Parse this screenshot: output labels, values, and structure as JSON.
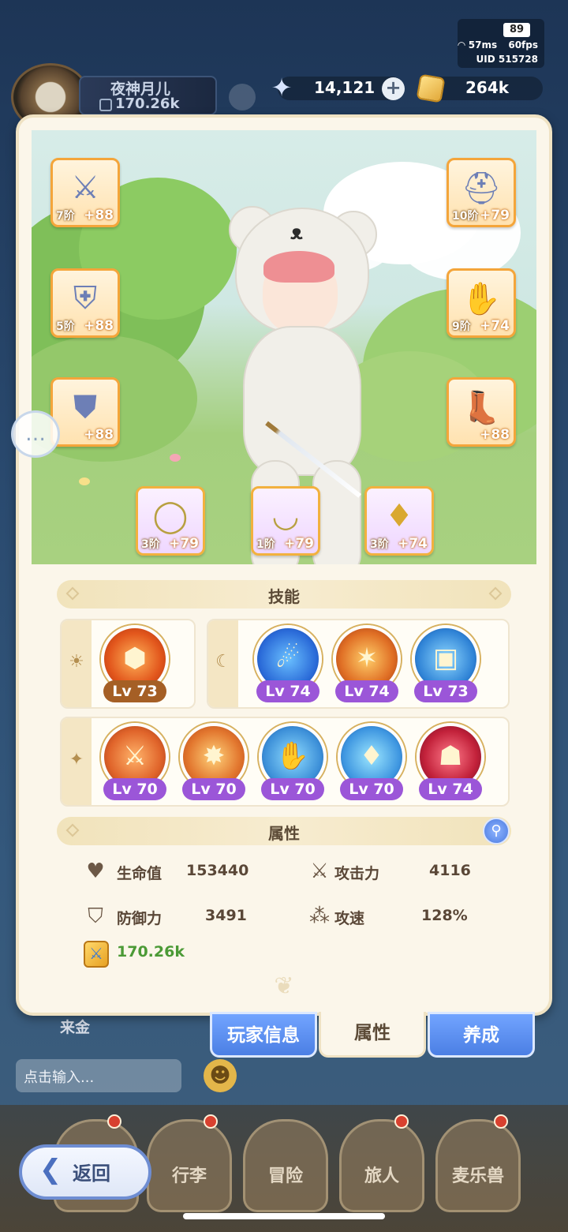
{
  "status": {
    "battery": "89",
    "ping": "57ms",
    "fps": "60fps",
    "uid": "UID 515728"
  },
  "player": {
    "name": "夜神月儿",
    "power": "170.26k"
  },
  "resources": {
    "crystals": "14,121",
    "plus_icon": "plus-icon",
    "gold": "264k"
  },
  "equipment": [
    {
      "slot": "weapon",
      "tier": "7阶",
      "plus": "+88",
      "icon": "sword-icon"
    },
    {
      "slot": "helmet",
      "tier": "10阶",
      "plus": "+79",
      "icon": "helmet-icon"
    },
    {
      "slot": "armor",
      "tier": "5阶",
      "plus": "+88",
      "icon": "chest-armor-icon"
    },
    {
      "slot": "gloves",
      "tier": "9阶",
      "plus": "+74",
      "icon": "gauntlet-icon"
    },
    {
      "slot": "pants",
      "tier": "",
      "plus": "+88",
      "icon": "leg-armor-icon"
    },
    {
      "slot": "boots",
      "tier": "",
      "plus": "+88",
      "icon": "boots-icon"
    },
    {
      "slot": "ring",
      "tier": "3阶",
      "plus": "+79",
      "icon": "ring-icon"
    },
    {
      "slot": "necklace",
      "tier": "1阶",
      "plus": "+79",
      "icon": "necklace-icon"
    },
    {
      "slot": "earring",
      "tier": "3阶",
      "plus": "+74",
      "icon": "earring-icon"
    }
  ],
  "skills": {
    "title": "技能",
    "sun_group": [
      {
        "level": "Lv 73",
        "icon": "fire-shield-skill-icon"
      }
    ],
    "moon_group": [
      {
        "level": "Lv 74",
        "icon": "blue-aura-skill-icon"
      },
      {
        "level": "Lv 74",
        "icon": "flame-strike-skill-icon"
      },
      {
        "level": "Lv 73",
        "icon": "ice-guard-skill-icon"
      }
    ],
    "star_group": [
      {
        "level": "Lv 70",
        "icon": "sword-shield-skill-icon"
      },
      {
        "level": "Lv 70",
        "icon": "burst-skill-icon"
      },
      {
        "level": "Lv 70",
        "icon": "grab-skill-icon"
      },
      {
        "level": "Lv 70",
        "icon": "blade-wind-skill-icon"
      },
      {
        "level": "Lv 74",
        "icon": "shadow-skill-icon"
      }
    ]
  },
  "attributes": {
    "title": "属性",
    "hp_label": "生命值",
    "hp_value": "153440",
    "atk_label": "攻击力",
    "atk_value": "4116",
    "def_label": "防御力",
    "def_value": "3491",
    "spd_label": "攻速",
    "spd_value": "128%",
    "power_value": "170.26k"
  },
  "tabs": {
    "player_info": "玩家信息",
    "attributes": "属性",
    "training": "养成"
  },
  "background": {
    "chat_name": "来金",
    "chat_placeholder": "点击输入..."
  },
  "nav": {
    "back": "返回",
    "bag": "行李",
    "adventure": "冒险",
    "traveler": "旅人",
    "pets": "麦乐兽"
  },
  "colors": {
    "accent_blue": "#4b7fe4",
    "equip_border": "#f4a53a",
    "lv_purple": "#9b56d8",
    "lv_brown": "#a55f25",
    "power_green": "#4b9a36"
  }
}
